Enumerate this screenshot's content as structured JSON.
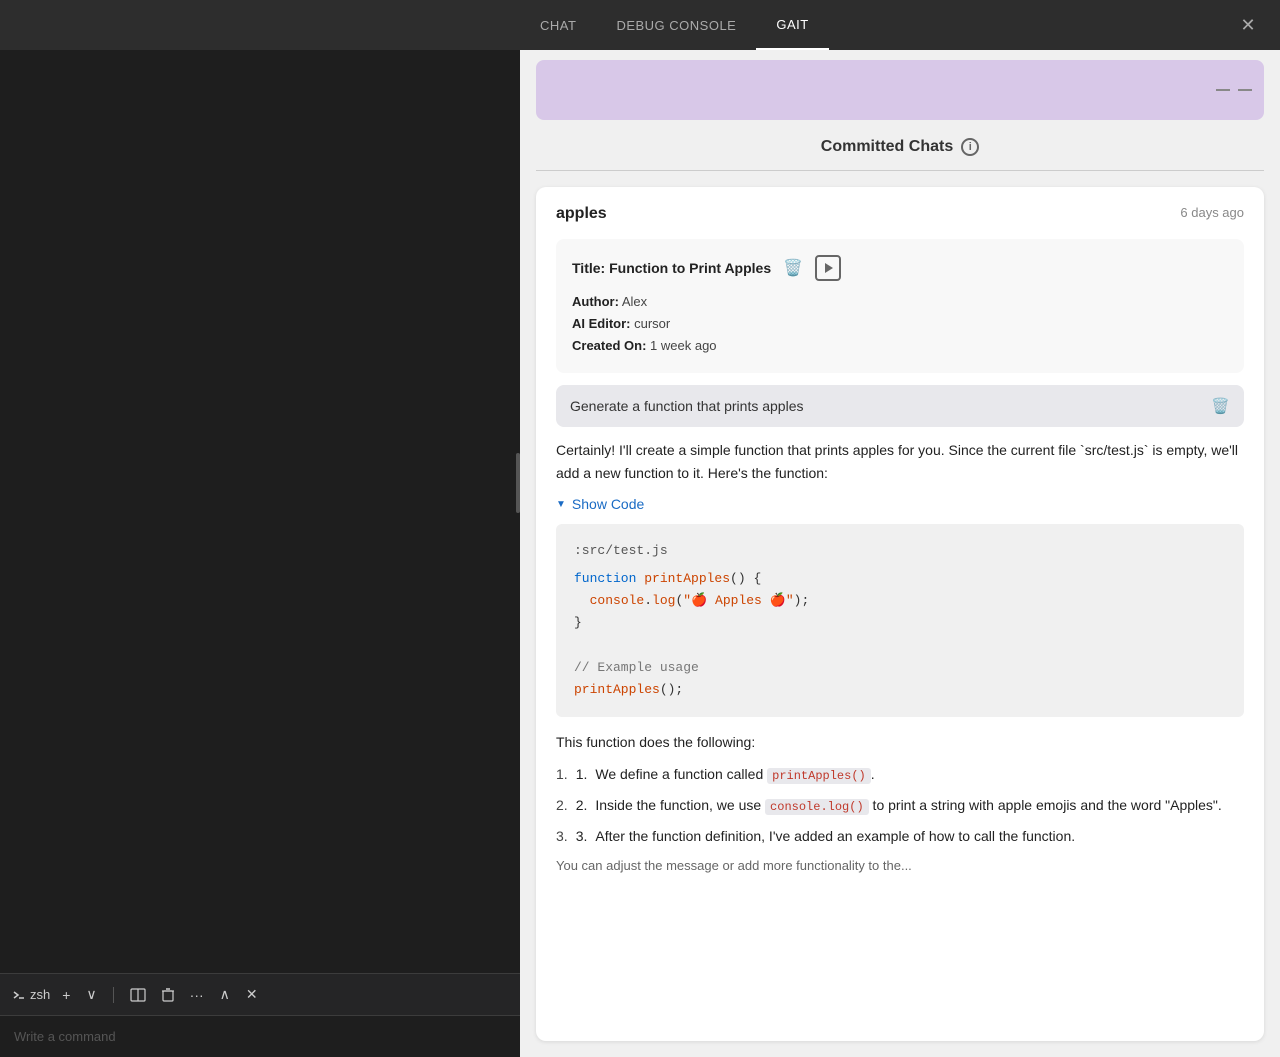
{
  "nav": {
    "tabs": [
      {
        "id": "chat",
        "label": "CHAT",
        "active": false
      },
      {
        "id": "debug",
        "label": "DEBUG CONSOLE",
        "active": false
      },
      {
        "id": "gait",
        "label": "GAIT",
        "active": true
      }
    ],
    "close_label": "✕"
  },
  "terminal": {
    "shell_label": "zsh",
    "input_placeholder": "Write a command",
    "buttons": [
      "+",
      "∨",
      "⊞",
      "🗑",
      "…",
      "∧",
      "✕"
    ]
  },
  "gait": {
    "committed_chats_title": "Committed Chats",
    "info_icon_label": "i",
    "chat_card": {
      "name": "apples",
      "timestamp": "6 days ago",
      "commit": {
        "title_label": "Title:",
        "title_value": "Function to Print Apples",
        "author_label": "Author:",
        "author_value": "Alex",
        "ai_editor_label": "AI Editor:",
        "ai_editor_value": "cursor",
        "created_label": "Created On:",
        "created_value": "1 week ago"
      },
      "user_message": "Generate a function that prints apples",
      "ai_intro": "Certainly! I'll create a simple function that prints apples for you. Since the current file `src/test.js` is empty, we'll add a new function to it. Here's the function:",
      "show_code_label": "Show Code",
      "code": {
        "file": ":src/test.js",
        "lines": [
          {
            "type": "plain",
            "content": "function printApples() {"
          },
          {
            "type": "console",
            "content": "  console.log(\"🍎 Apples 🍎\");"
          },
          {
            "type": "plain",
            "content": "}"
          },
          {
            "type": "blank",
            "content": ""
          },
          {
            "type": "comment",
            "content": "// Example usage"
          },
          {
            "type": "plain",
            "content": "printApples();"
          }
        ]
      },
      "desc_text": "This function does the following:",
      "list_items": [
        {
          "text_before": "We define a function called ",
          "code": "printApples()",
          "text_after": "."
        },
        {
          "text_before": "Inside the function, we use ",
          "code": "console.log()",
          "text_after": " to print a string with apple emojis and the word \"Apples\"."
        },
        {
          "text_before": "After the function definition, I've added an example of how to call the function.",
          "code": "",
          "text_after": ""
        }
      ],
      "bottom_text": "You can adjust the message or add more functionality to the..."
    }
  }
}
